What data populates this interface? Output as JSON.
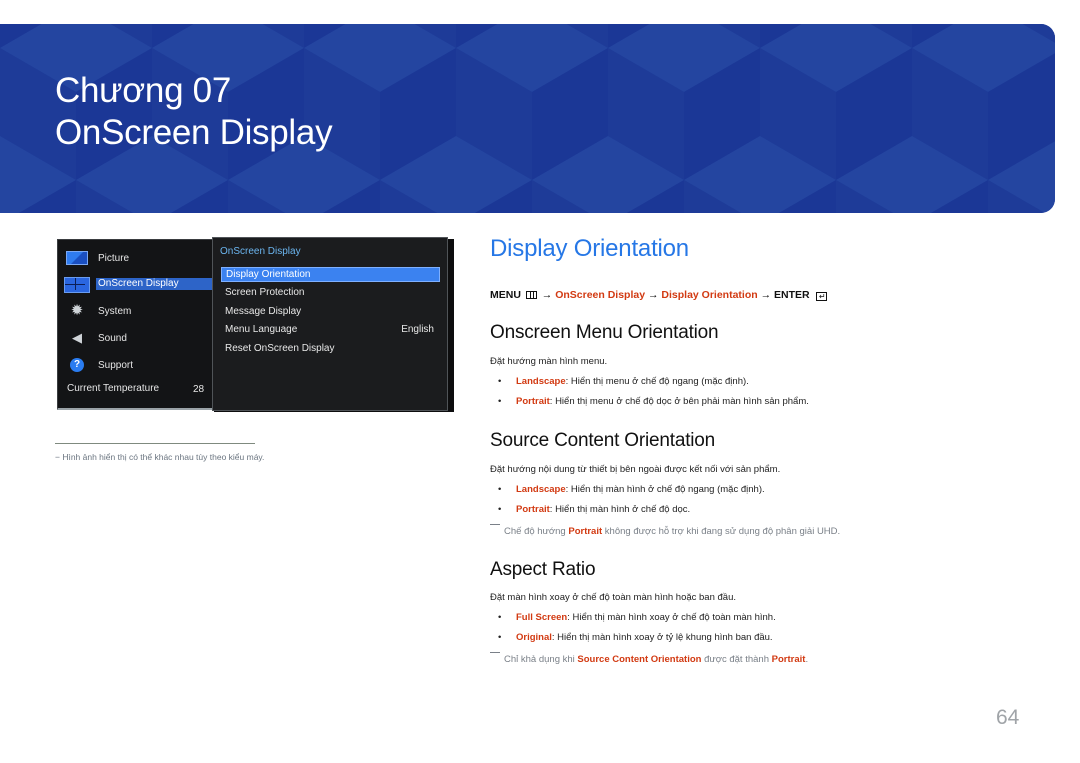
{
  "banner": {
    "chapter": "Chương 07",
    "title": "OnScreen Display"
  },
  "osd_menu": {
    "left_items": [
      {
        "label": "Picture",
        "icon": "picture-icon"
      },
      {
        "label": "OnScreen Display",
        "icon": "onscreen-display-icon",
        "selected": true
      },
      {
        "label": "System",
        "icon": "gear-icon"
      },
      {
        "label": "Sound",
        "icon": "speaker-icon"
      },
      {
        "label": "Support",
        "icon": "help-icon"
      }
    ],
    "temperature_label": "Current Temperature",
    "temperature_value": "28",
    "submenu_title": "OnScreen Display",
    "submenu_items": [
      {
        "label": "Display Orientation",
        "value": "",
        "selected": true
      },
      {
        "label": "Screen Protection",
        "value": ""
      },
      {
        "label": "Message Display",
        "value": ""
      },
      {
        "label": "Menu Language",
        "value": "English"
      },
      {
        "label": "Reset OnScreen Display",
        "value": ""
      }
    ]
  },
  "footnote": "−  Hình ảnh hiển thị có thể khác nhau tùy theo kiểu máy.",
  "section": {
    "title": "Display Orientation",
    "menu_path": {
      "menu": "MENU",
      "arrow": "→",
      "step1": "OnScreen Display",
      "step2": "Display Orientation",
      "enter": "ENTER"
    },
    "subsections": [
      {
        "heading": "Onscreen Menu Orientation",
        "description": "Đặt hướng màn hình menu.",
        "options": [
          {
            "key": "Landscape",
            "text": ": Hiển thị menu ở chế độ ngang (mặc định)."
          },
          {
            "key": "Portrait",
            "text": ": Hiển thị menu ở chế độ dọc ở bên phải màn hình sản phẩm."
          }
        ]
      },
      {
        "heading": "Source Content Orientation",
        "description": "Đặt hướng nội dung từ thiết bị bên ngoài được kết nối với sản phẩm.",
        "options": [
          {
            "key": "Landscape",
            "text": ": Hiển thị màn hình ở chế độ ngang (mặc định)."
          },
          {
            "key": "Portrait",
            "text": ": Hiển thị màn hình ở chế độ dọc."
          }
        ],
        "note": {
          "before": "Chế độ hướng ",
          "key": "Portrait",
          "after": " không được hỗ trợ khi đang sử dụng độ phân giải UHD."
        }
      },
      {
        "heading": "Aspect Ratio",
        "description": "Đặt màn hình xoay ở chế độ toàn màn hình hoặc ban đầu.",
        "options": [
          {
            "key": "Full Screen",
            "text": ": Hiển thị màn hình xoay ở chế độ toàn màn hình."
          },
          {
            "key": "Original",
            "text": ": Hiển thị màn hình xoay ở tỷ lệ khung hình ban đầu."
          }
        ],
        "note": {
          "before": "Chỉ khả dụng khi ",
          "key": "Source Content Orientation",
          "mid": " được đặt thành ",
          "key2": "Portrait",
          "after": "."
        }
      }
    ]
  },
  "page_number": "64",
  "colors": {
    "banner_blue": "#1f3f9c",
    "heading_blue": "#2677e6",
    "accent_red": "#d23a12",
    "osd_highlight": "#3b82f0"
  }
}
